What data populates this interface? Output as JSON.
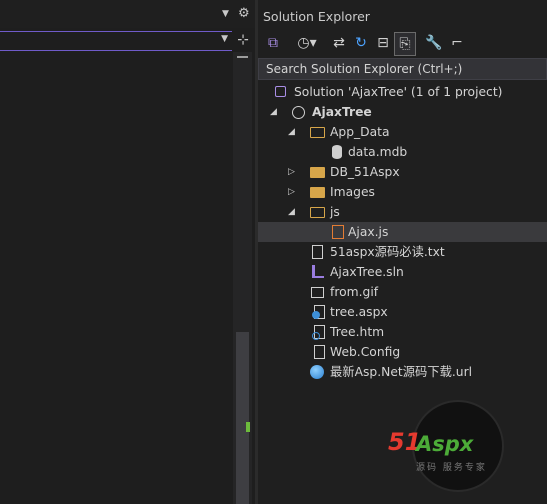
{
  "editor": {
    "nav_dropdown_value": ""
  },
  "solution_explorer": {
    "title": "Solution Explorer",
    "search": {
      "placeholder": "Search Solution Explorer (Ctrl+;)"
    },
    "toolbar": [
      {
        "name": "switch-views-icon"
      },
      {
        "name": "history-icon"
      },
      {
        "name": "sync-icon"
      },
      {
        "name": "refresh-icon"
      },
      {
        "name": "collapse-all-icon"
      },
      {
        "name": "show-all-files-icon"
      },
      {
        "name": "properties-wrench-icon"
      },
      {
        "name": "preview-icon"
      }
    ],
    "tree": {
      "solution": "Solution 'AjaxTree' (1 of 1 project)",
      "project": "AjaxTree",
      "app_data": "App_Data",
      "data_mdb": "data.mdb",
      "db_51aspx": "DB_51Aspx",
      "images": "Images",
      "js": "js",
      "ajax_js": "Ajax.js",
      "readme_txt": "51aspx源码必读.txt",
      "sln_file": "AjaxTree.sln",
      "from_gif": "from.gif",
      "tree_aspx": "tree.aspx",
      "tree_htm": "Tree.htm",
      "web_config": "Web.Config",
      "latest_url": "最新Asp.Net源码下载.url"
    }
  },
  "watermark": {
    "logo_num": "51",
    "logo_text": "Aspx",
    "tagline": "源码 服务专家"
  },
  "colors": {
    "background": "#1f1f1f",
    "accent": "#6f5bc9",
    "folder": "#d7a64a",
    "js": "#e37c34",
    "logo_red": "#e53a2f",
    "logo_green": "#4cab38"
  }
}
